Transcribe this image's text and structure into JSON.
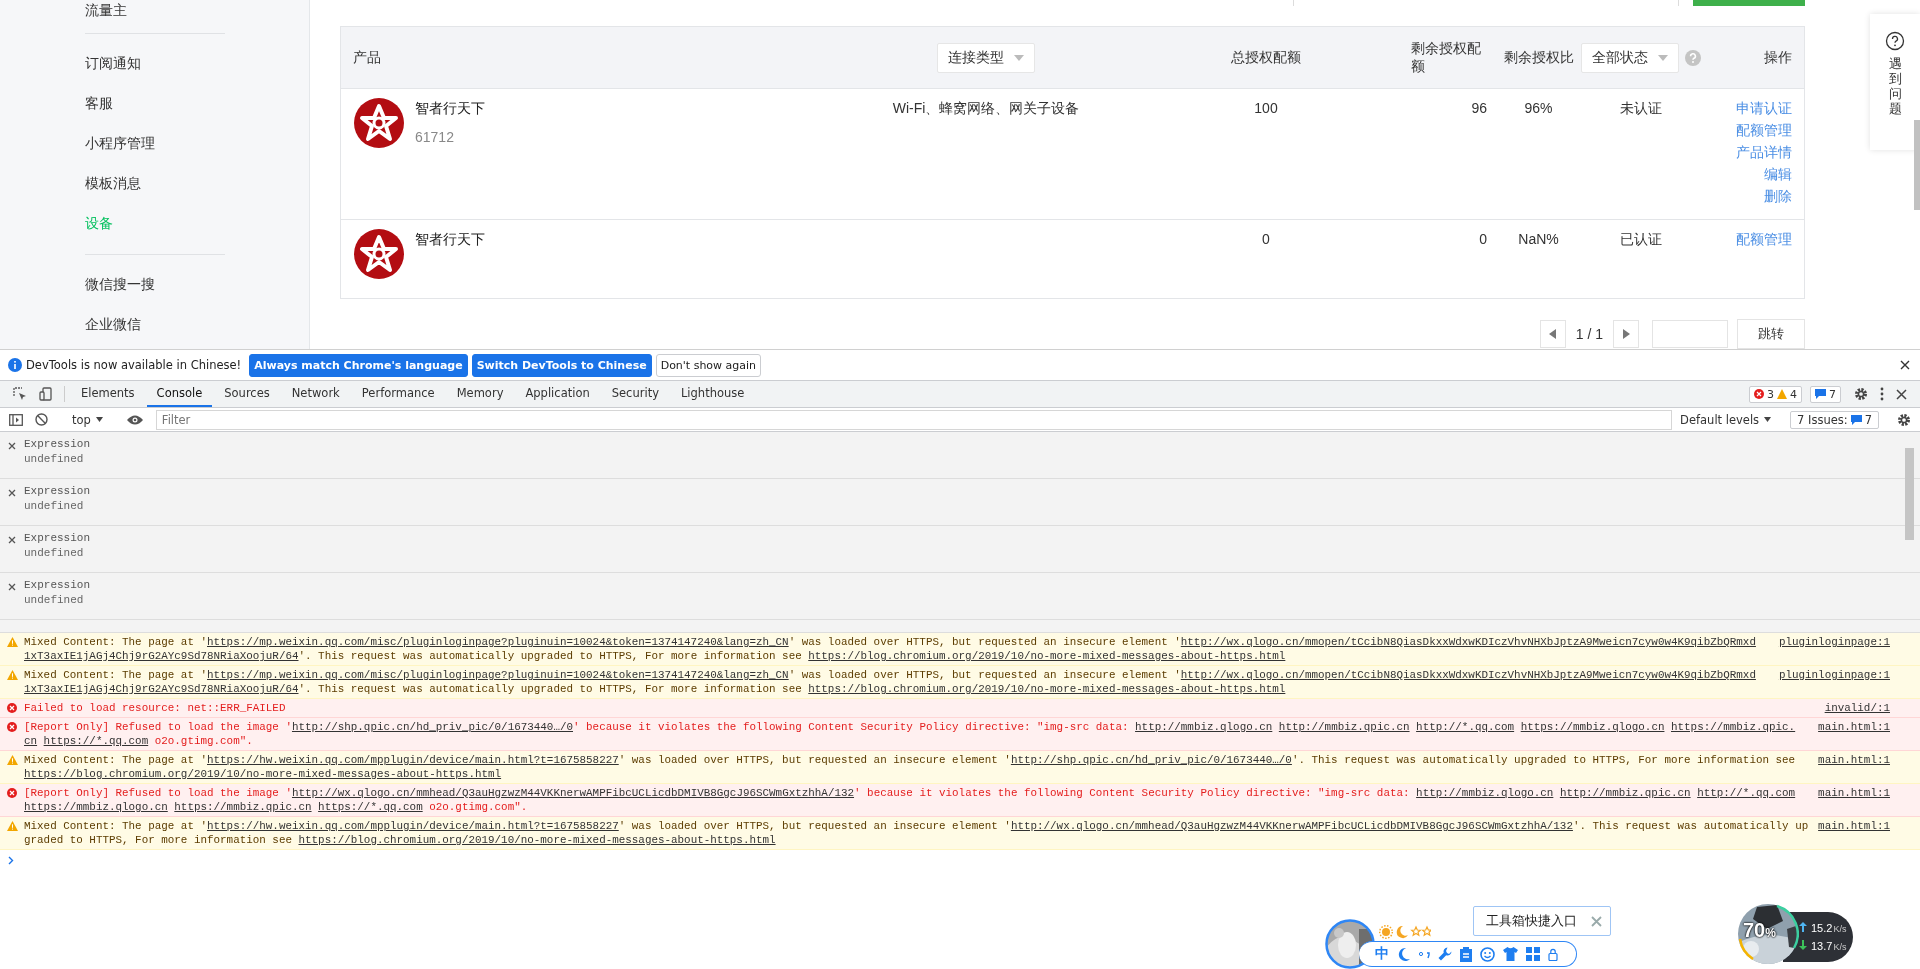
{
  "page": {
    "sidebar": {
      "groups": [
        {
          "items": [
            {
              "label": "流量主",
              "selected": false
            }
          ]
        },
        {
          "items": [
            {
              "label": "订阅通知",
              "selected": false
            },
            {
              "label": "客服",
              "selected": false
            },
            {
              "label": "小程序管理",
              "selected": false
            },
            {
              "label": "模板消息",
              "selected": false
            },
            {
              "label": "设备",
              "selected": true
            }
          ]
        },
        {
          "items": [
            {
              "label": "微信搜一搜",
              "selected": false
            },
            {
              "label": "企业微信",
              "selected": false
            }
          ]
        }
      ]
    },
    "table": {
      "columns": [
        {
          "label": "产品",
          "kind": "text"
        },
        {
          "label": "连接类型",
          "kind": "dropdown"
        },
        {
          "label": "总授权配额",
          "kind": "text"
        },
        {
          "label": "剩余授权配额",
          "kind": "text"
        },
        {
          "label": "剩余授权比",
          "kind": "text"
        },
        {
          "label": "全部状态",
          "kind": "dropdown",
          "help": true
        },
        {
          "label": "操作",
          "kind": "text"
        }
      ],
      "rows": [
        {
          "name": "智者行天下",
          "id": "61712",
          "connection": "Wi-Fi、蜂窝网络、网关子设备",
          "total": "100",
          "remaining": "96",
          "ratio": "96%",
          "status": "未认证",
          "actions": [
            "申请认证",
            "配额管理",
            "产品详情",
            "编辑",
            "删除"
          ]
        },
        {
          "name": "智者行天下",
          "total": "0",
          "remaining": "0",
          "ratio": "NaN%",
          "status": "已认证",
          "actions": [
            "配额管理"
          ]
        }
      ]
    },
    "pagination": {
      "page": "1 / 1",
      "go": "跳转"
    },
    "help_card": {
      "label": "遇到问题"
    }
  },
  "devtools": {
    "infobar": {
      "message": "DevTools is now available in Chinese!",
      "buttons": [
        {
          "label": "Always match Chrome's language",
          "primary": true
        },
        {
          "label": "Switch DevTools to Chinese",
          "primary": true
        },
        {
          "label": "Don't show again",
          "primary": false
        }
      ]
    },
    "tabs": [
      {
        "label": "Elements",
        "selected": false
      },
      {
        "label": "Console",
        "selected": true
      },
      {
        "label": "Sources",
        "selected": false
      },
      {
        "label": "Network",
        "selected": false
      },
      {
        "label": "Performance",
        "selected": false
      },
      {
        "label": "Memory",
        "selected": false
      },
      {
        "label": "Application",
        "selected": false
      },
      {
        "label": "Security",
        "selected": false
      },
      {
        "label": "Lighthouse",
        "selected": false
      }
    ],
    "counts": {
      "errors": "3",
      "warnings": "4",
      "messages": "7"
    },
    "context": "top",
    "filter_placeholder": "Filter",
    "levels": "Default levels",
    "issues": {
      "label": "7 Issues:",
      "count": "7"
    },
    "live_expressions": [
      {
        "expression": "Expression",
        "value": "undefined"
      },
      {
        "expression": "Expression",
        "value": "undefined"
      },
      {
        "expression": "Expression",
        "value": "undefined"
      },
      {
        "expression": "Expression",
        "value": "undefined"
      }
    ],
    "messages": [
      {
        "kind": "warning",
        "source": "pluginloginpage:1",
        "parts": [
          {
            "text": "Mixed Content: The page at '"
          },
          {
            "text": "https://mp.weixin.qq.com/misc/pluginloginpage?pluginuin=10024&token=1374147240&lang=zh_CN",
            "link": true
          },
          {
            "text": "' was loaded over HTTPS, but requested an insecure element '"
          },
          {
            "text": "http://wx.qlogo.cn/mmopen/tCcibN8QiasDkxxWdxwKDIczVhvNHXbJptzA9Mweicn7cyw0w4K9qibZbQRmxd",
            "link": true
          },
          {
            "text": "1xT3axIE1jAGj4Chj9rG2AYc9Sd78NRiaXoojuR/64",
            "link": true
          },
          {
            "text": "'. This request was automatically upgraded to HTTPS, For more information see "
          },
          {
            "text": "https://blog.chromium.org/2019/10/no-more-mixed-messages-about-https.html",
            "link": true
          }
        ]
      },
      {
        "kind": "warning",
        "source": "pluginloginpage:1",
        "parts": [
          {
            "text": "Mixed Content: The page at '"
          },
          {
            "text": "https://mp.weixin.qq.com/misc/pluginloginpage?pluginuin=10024&token=1374147240&lang=zh_CN",
            "link": true
          },
          {
            "text": "' was loaded over HTTPS, but requested an insecure element '"
          },
          {
            "text": "http://wx.qlogo.cn/mmopen/tCcibN8QiasDkxxWdxwKDIczVhvNHXbJptzA9Mweicn7cyw0w4K9qibZbQRmxd",
            "link": true
          },
          {
            "text": "1xT3axIE1jAGj4Chj9rG2AYc9Sd78NRiaXoojuR/64",
            "link": true
          },
          {
            "text": "'. This request was automatically upgraded to HTTPS, For more information see "
          },
          {
            "text": "https://blog.chromium.org/2019/10/no-more-mixed-messages-about-https.html",
            "link": true
          }
        ]
      },
      {
        "kind": "error",
        "source": "invalid/:1",
        "parts": [
          {
            "text": "Failed to load resource: net::ERR_FAILED"
          }
        ]
      },
      {
        "kind": "error",
        "source": "main.html:1",
        "parts": [
          {
            "text": "[Report Only] Refused to load the image '"
          },
          {
            "text": "http://shp.qpic.cn/hd_priv_pic/0/1673440…/0",
            "link": true
          },
          {
            "text": "' because it violates the following Content Security Policy directive: \"img-src data: "
          },
          {
            "text": "http://mmbiz.qlogo.cn",
            "link": true,
            "space_after": true
          },
          {
            "text": "http://mmbiz.qpic.cn",
            "link": true,
            "space_after": true
          },
          {
            "text": "http://*.qq.com",
            "link": true,
            "space_after": true
          },
          {
            "text": "https://mmbiz.qlogo.cn",
            "link": true,
            "space_after": true
          },
          {
            "text": "https://mmbiz.qpic.",
            "link": true
          },
          {
            "text": "cn",
            "link": true,
            "space_after": true
          },
          {
            "text": "https://*.qq.com",
            "link": true
          },
          {
            "text": " o2o.gtimg.com\"."
          }
        ]
      },
      {
        "kind": "warning",
        "source": "main.html:1",
        "parts": [
          {
            "text": "Mixed Content: The page at '"
          },
          {
            "text": "https://hw.weixin.qq.com/mpplugin/device/main.html?t=1675858227",
            "link": true
          },
          {
            "text": "' was loaded over HTTPS, but requested an insecure element '"
          },
          {
            "text": "http://shp.qpic.cn/hd_priv_pic/0/1673440…/0",
            "link": true
          },
          {
            "text": "'. This request was automatically upgraded to HTTPS, For more information see "
          },
          {
            "text": "https://blog.chromium.org/2019/10/no-more-mixed-messages-about-https.html",
            "link": true
          }
        ]
      },
      {
        "kind": "error",
        "source": "main.html:1",
        "parts": [
          {
            "text": "[Report Only] Refused to load the image '"
          },
          {
            "text": "http://wx.qlogo.cn/mmhead/Q3auHgzwzM44VKKnerwAMPFibcUCLicdbDMIVB8GgcJ96SCWmGxtzhhA/132",
            "link": true
          },
          {
            "text": "' because it violates the following Content Security Policy directive: \"img-src data: "
          },
          {
            "text": "http://mmbiz.qlogo.cn",
            "link": true,
            "space_after": true
          },
          {
            "text": "http://mmbiz.qpic.cn",
            "link": true,
            "space_after": true
          },
          {
            "text": "http://*.qq.com",
            "link": true,
            "space_after": true
          },
          {
            "text": "https://mmbiz.qlogo.cn",
            "link": true,
            "space_after": true
          },
          {
            "text": "https://mmbiz.qpic.cn",
            "link": true,
            "space_after": true
          },
          {
            "text": "https://*.qq.com",
            "link": true
          },
          {
            "text": " o2o.gtimg.com\"."
          }
        ]
      },
      {
        "kind": "warning",
        "source": "main.html:1",
        "parts": [
          {
            "text": "Mixed Content: The page at '"
          },
          {
            "text": "https://hw.weixin.qq.com/mpplugin/device/main.html?t=1675858227",
            "link": true
          },
          {
            "text": "' was loaded over HTTPS, but requested an insecure element '"
          },
          {
            "text": "http://wx.qlogo.cn/mmhead/Q3auHgzwzM44VKKnerwAMPFibcUCLicdbDMIVB8GgcJ96SCWmGxtzhhA/132",
            "link": true
          },
          {
            "text": "'. This request was automatically upgraded to HTTPS, For more information see "
          },
          {
            "text": "https://blog.chromium.org/2019/10/no-more-mixed-messages-about-https.html",
            "link": true
          }
        ]
      }
    ]
  },
  "widgets": {
    "ime_toolbar": {
      "mode": "中",
      "tooltip": "工具箱快捷入口"
    },
    "network_meter": {
      "percent": "70",
      "percent_unit": "%",
      "upload": {
        "value": "15.2",
        "unit": "K/s"
      },
      "download": {
        "value": "13.7",
        "unit": "K/s"
      }
    }
  }
}
